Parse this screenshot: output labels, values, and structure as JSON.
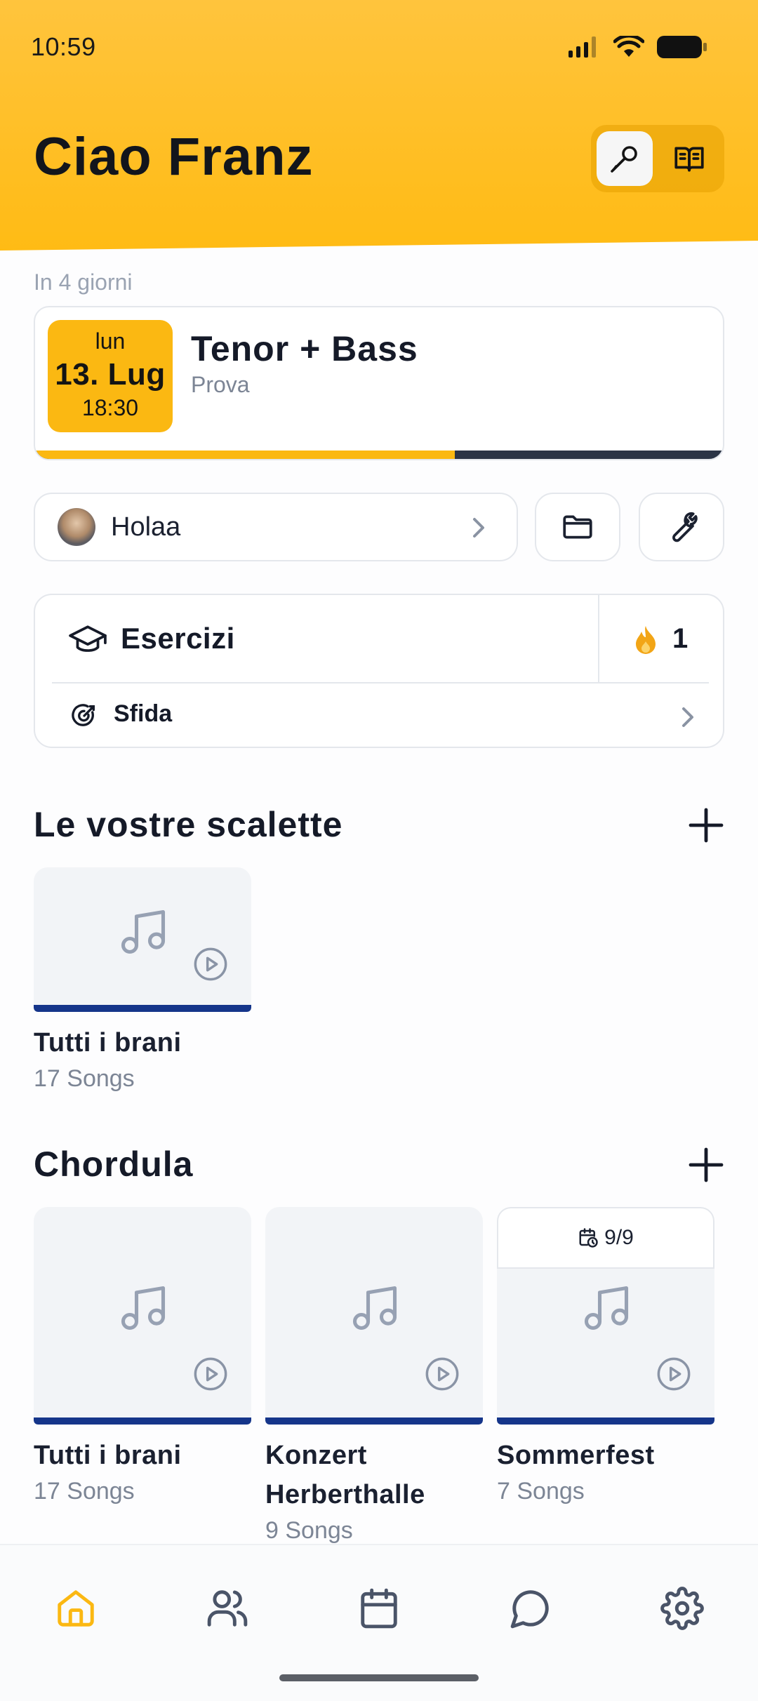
{
  "status_bar": {
    "time": "10:59"
  },
  "header": {
    "greeting": "Ciao Franz"
  },
  "colors": {
    "accent": "#fbb812",
    "navy": "#15358a",
    "muted": "#7c8595",
    "border": "#e4e7ec"
  },
  "next_event": {
    "relative_label": "In 4 giorni",
    "weekday": "lun",
    "date": "13. Lug",
    "time": "18:30",
    "title": "Tenor + Bass",
    "type": "Prova",
    "progress_fraction": 0.61
  },
  "user_pill": {
    "name": "Holaa"
  },
  "exercises": {
    "title": "Esercizi",
    "streak": "1",
    "challenge": "Sfida"
  },
  "setlists": {
    "title": "Le vostre scalette",
    "items": [
      {
        "label": "Tutti i brani",
        "count": "17 Songs"
      }
    ]
  },
  "group": {
    "title": "Chordula",
    "items": [
      {
        "label": "Tutti i brani",
        "count": "17 Songs"
      },
      {
        "label": "Konzert Herberthalle",
        "count": "9 Songs"
      },
      {
        "label": "Sommerfest",
        "count": "7 Songs",
        "badge": "9/9"
      }
    ]
  },
  "bottom_nav": {
    "items": [
      {
        "icon": "home-icon",
        "active": true
      },
      {
        "icon": "users-icon",
        "active": false
      },
      {
        "icon": "calendar-icon",
        "active": false
      },
      {
        "icon": "chat-icon",
        "active": false
      },
      {
        "icon": "gear-icon",
        "active": false
      }
    ]
  }
}
